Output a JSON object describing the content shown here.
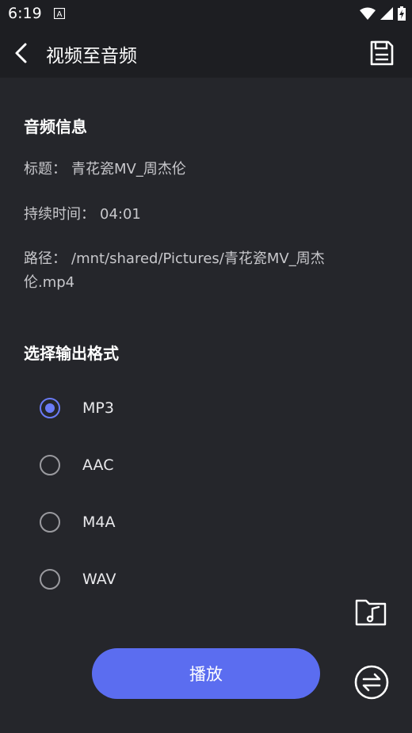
{
  "status_bar": {
    "time": "6:19",
    "icons": [
      "notification-a-icon",
      "wifi-icon",
      "signal-icon",
      "battery-charging-icon"
    ]
  },
  "app_bar": {
    "title": "视频至音频",
    "back_icon": "back-arrow-icon",
    "save_icon": "save-icon"
  },
  "audio_info": {
    "heading": "音频信息",
    "title_label": "标题：",
    "title_value": "青花瓷MV_周杰伦",
    "duration_label": "持续时间：",
    "duration_value": "04:01",
    "path_label": "路径：",
    "path_value_line1": "/mnt/shared/Pictures/青花瓷MV_周杰",
    "path_value_line2": "伦.mp4"
  },
  "output_format": {
    "heading": "选择输出格式",
    "options": [
      {
        "label": "MP3",
        "selected": true
      },
      {
        "label": "AAC",
        "selected": false
      },
      {
        "label": "M4A",
        "selected": false
      },
      {
        "label": "WAV",
        "selected": false
      }
    ]
  },
  "actions": {
    "play_label": "播放",
    "music_folder_icon": "music-folder-icon",
    "convert_icon": "convert-icon"
  },
  "colors": {
    "background": "#25262b",
    "bar": "#1d1e22",
    "accent": "#5b6df0"
  }
}
